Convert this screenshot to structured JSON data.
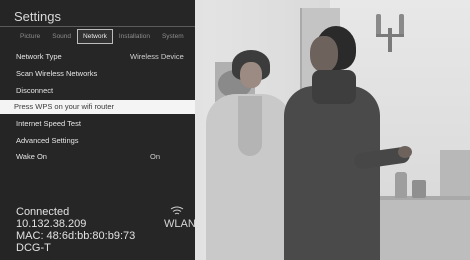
{
  "app": {
    "title": "Settings"
  },
  "tabs": [
    {
      "label": "Picture",
      "active": false
    },
    {
      "label": "Sound",
      "active": false
    },
    {
      "label": "Network",
      "active": true
    },
    {
      "label": "Installation",
      "active": false
    },
    {
      "label": "System",
      "active": false
    }
  ],
  "menu": {
    "items": [
      {
        "label": "Network Type",
        "value": "Wireless Device"
      },
      {
        "label": "Scan Wireless Networks",
        "value": ""
      },
      {
        "label": "Disconnect",
        "value": ""
      },
      {
        "label": "Press WPS on your wifi router",
        "value": "",
        "selected": true
      },
      {
        "label": "Internet Speed Test",
        "value": ""
      },
      {
        "label": "Advanced Settings",
        "value": ""
      },
      {
        "label": "Wake On",
        "value": "On"
      }
    ]
  },
  "status": {
    "connection": "Connected",
    "ip": "10.132.38.209",
    "mac": "MAC: 48:6d:bb:80:b9:73",
    "device": "DCG-T",
    "wlan_label": "WLAN",
    "wlan_icon": "wifi-icon"
  },
  "colors": {
    "selected_bg": "#f4f4f4",
    "panel_bg": "#161616"
  }
}
